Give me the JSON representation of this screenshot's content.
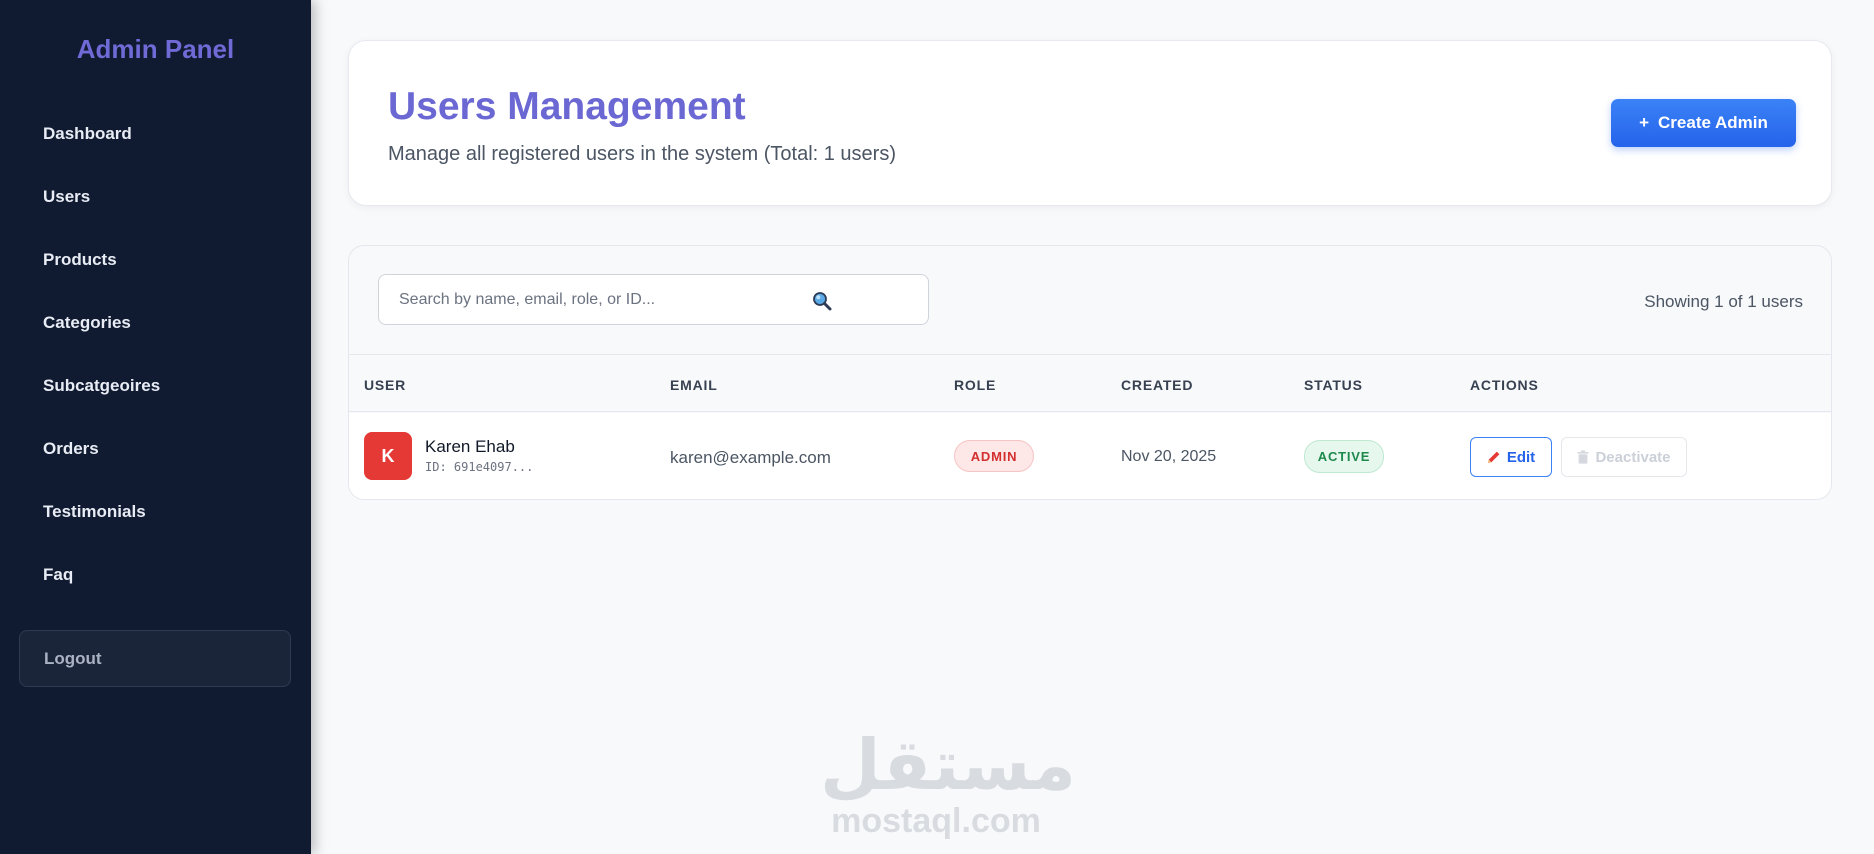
{
  "sidebar": {
    "brand": "Admin Panel",
    "items": [
      {
        "label": "Dashboard"
      },
      {
        "label": "Users"
      },
      {
        "label": "Products"
      },
      {
        "label": "Categories"
      },
      {
        "label": "Subcatgeoires"
      },
      {
        "label": "Orders"
      },
      {
        "label": "Testimonials"
      },
      {
        "label": "Faq"
      }
    ],
    "logout_label": "Logout"
  },
  "header": {
    "title": "Users Management",
    "subtitle": "Manage all registered users in the system (Total: 1 users)",
    "create_button_icon": "+",
    "create_button_label": "Create Admin"
  },
  "search": {
    "placeholder": "Search by name, email, role, or ID...",
    "value": "",
    "icon": "magnifier-icon"
  },
  "showing_text": "Showing 1 of 1 users",
  "table": {
    "columns": [
      "USER",
      "EMAIL",
      "ROLE",
      "CREATED",
      "STATUS",
      "ACTIONS"
    ],
    "rows": [
      {
        "avatar_letter": "K",
        "name": "Karen Ehab",
        "id": "ID: 691e4097...",
        "email": "karen@example.com",
        "role": "ADMIN",
        "created": "Nov 20, 2025",
        "status": "ACTIVE",
        "edit_label": "Edit",
        "deactivate_label": "Deactivate"
      }
    ]
  },
  "watermark": {
    "arabic": "مستقل",
    "latin": "mostaql.com"
  },
  "colors": {
    "sidebar_bg": "#101a30",
    "brand": "#6f6ad6",
    "primary": "#2563eb",
    "admin_badge": "#d32f2f",
    "active_badge": "#1e8a4c",
    "avatar": "#e53935"
  }
}
